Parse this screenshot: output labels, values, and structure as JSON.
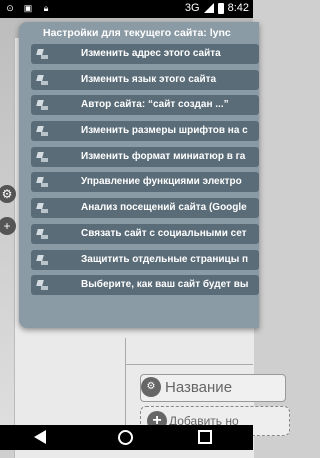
{
  "status_bar": {
    "left_icons": [
      "notification-icon-1",
      "image-icon",
      "lock-icon"
    ],
    "network": "3G",
    "time": "8:42"
  },
  "background": {
    "name_field_label": "Название",
    "add_button_label": "Добавить но"
  },
  "popup": {
    "title": "Настройки для текущего сайта: lync",
    "items": [
      {
        "label": "Изменить адрес этого сайта"
      },
      {
        "label": "Изменить язык этого сайта"
      },
      {
        "label": "Автор сайта: “сайт создан ...”"
      },
      {
        "label": "Изменить размеры шрифтов на с"
      },
      {
        "label": "Изменить формат миниатюр в га"
      },
      {
        "label": "Управление функциями электро"
      },
      {
        "label": "Анализ посещений сайта (Google"
      },
      {
        "label": "Связать сайт с социальными сет"
      },
      {
        "label": "Защитить отдельные страницы п"
      },
      {
        "label": "Выберите, как ваш сайт будет вы"
      }
    ]
  }
}
